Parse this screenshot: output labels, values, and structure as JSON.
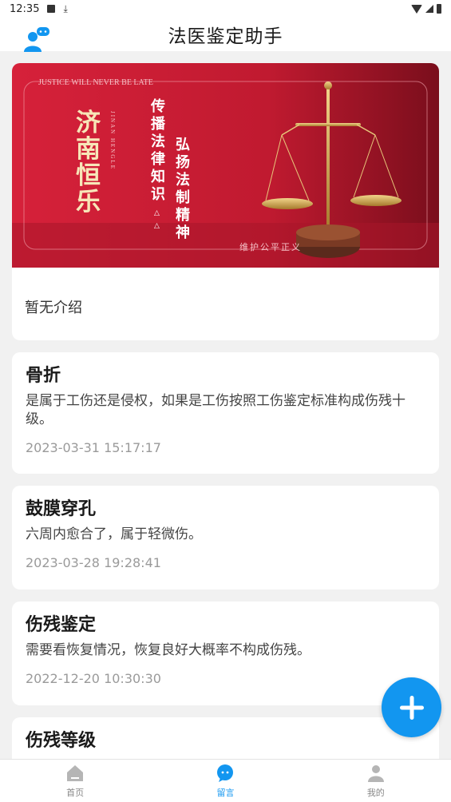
{
  "status_bar": {
    "time": "12:35"
  },
  "header": {
    "title": "法医鉴定助手"
  },
  "intro": {
    "banner": {
      "top_text": "JUSTICE WILL NEVER BE LATE",
      "brand": "济南恒乐",
      "brand_pinyin": "JINAN HENGLE",
      "slogan_1": "传播法律知识",
      "slogan_2": "弘扬法制精神",
      "bottom_text": "维护公平正义"
    },
    "text": "暂无介绍"
  },
  "messages": [
    {
      "title": "骨折",
      "body": "是属于工伤还是侵权，如果是工伤按照工伤鉴定标准构成伤残十级。",
      "time": "2023-03-31 15:17:17"
    },
    {
      "title": "鼓膜穿孔",
      "body": "六周内愈合了，属于轻微伤。",
      "time": "2023-03-28 19:28:41"
    },
    {
      "title": "伤残鉴定",
      "body": "需要看恢复情况，恢复良好大概率不构成伤残。",
      "time": "2022-12-20 10:30:30"
    },
    {
      "title": "伤残等级",
      "body": "",
      "time": ""
    }
  ],
  "tabs": [
    {
      "label": "首页",
      "icon": "home-icon"
    },
    {
      "label": "留言",
      "icon": "chat-icon"
    },
    {
      "label": "我的",
      "icon": "profile-icon"
    }
  ],
  "colors": {
    "accent": "#1296f0",
    "banner_red": "#c8102e"
  }
}
